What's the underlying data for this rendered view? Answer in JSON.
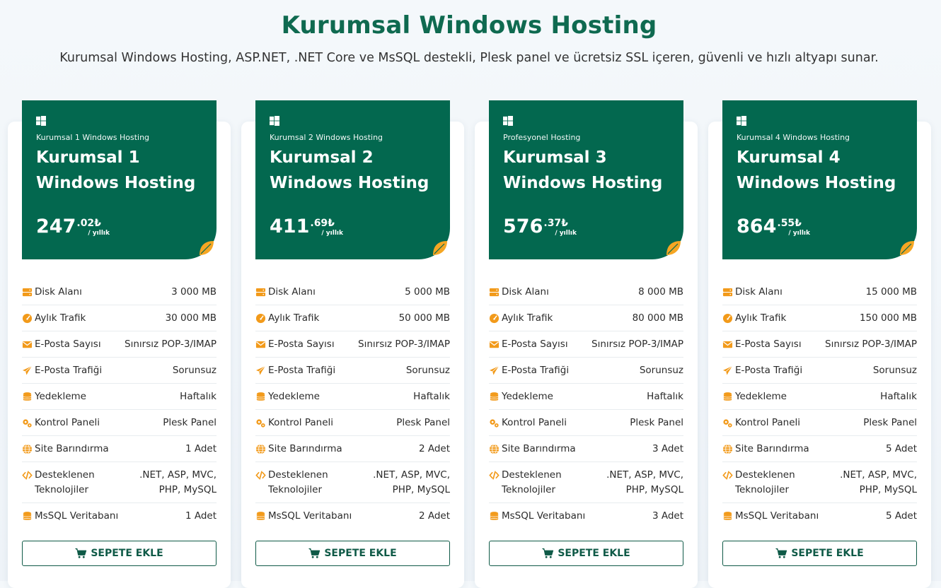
{
  "header": {
    "title": "Kurumsal Windows Hosting",
    "subtitle": "Kurumsal Windows Hosting, ASP.NET, .NET Core ve MsSQL destekli, Plesk panel ve ücretsiz SSL içeren, güvenli ve hızlı altyapı sunar."
  },
  "colors": {
    "brand": "#03684f",
    "accent": "#f5a623",
    "icon": "#f29a1a"
  },
  "labels": {
    "disk": "Disk Alanı",
    "traffic": "Aylık Trafik",
    "email_count": "E-Posta Sayısı",
    "email_traffic": "E-Posta Trafiği",
    "backup": "Yedekleme",
    "panel": "Kontrol Paneli",
    "sites": "Site Barındırma",
    "tech": "Desteklenen Teknolojiler",
    "mssql": "MsSQL Veritabanı"
  },
  "plans": [
    {
      "subtitle": "Kurumsal 1 Windows Hosting",
      "title": "Kurumsal 1 Windows Hosting",
      "price_int": "247",
      "price_dec": ".02₺",
      "price_per": "/ yıllık",
      "disk": "3 000 MB",
      "traffic": "30 000 MB",
      "email_count": "Sınırsız POP-3/IMAP",
      "email_traffic": "Sorunsuz",
      "backup": "Haftalık",
      "panel": "Plesk Panel",
      "sites": "1 Adet",
      "tech": ".NET, ASP, MVC, PHP, MySQL",
      "mssql": "1 Adet",
      "button": "SEPETE EKLE"
    },
    {
      "subtitle": "Kurumsal 2 Windows Hosting",
      "title": "Kurumsal 2 Windows Hosting",
      "price_int": "411",
      "price_dec": ".69₺",
      "price_per": "/ yıllık",
      "disk": "5 000 MB",
      "traffic": "50 000 MB",
      "email_count": "Sınırsız POP-3/IMAP",
      "email_traffic": "Sorunsuz",
      "backup": "Haftalık",
      "panel": "Plesk Panel",
      "sites": "2 Adet",
      "tech": ".NET, ASP, MVC, PHP, MySQL",
      "mssql": "2 Adet",
      "button": "SEPETE EKLE"
    },
    {
      "subtitle": "Profesyonel Hosting",
      "title": "Kurumsal 3 Windows Hosting",
      "price_int": "576",
      "price_dec": ".37₺",
      "price_per": "/ yıllık",
      "disk": "8 000 MB",
      "traffic": "80 000 MB",
      "email_count": "Sınırsız POP-3/IMAP",
      "email_traffic": "Sorunsuz",
      "backup": "Haftalık",
      "panel": "Plesk Panel",
      "sites": "3 Adet",
      "tech": ".NET, ASP, MVC, PHP, MySQL",
      "mssql": "3 Adet",
      "button": "SEPETE EKLE"
    },
    {
      "subtitle": "Kurumsal 4 Windows Hosting",
      "title": "Kurumsal 4 Windows Hosting",
      "price_int": "864",
      "price_dec": ".55₺",
      "price_per": "/ yıllık",
      "disk": "15 000 MB",
      "traffic": "150 000 MB",
      "email_count": "Sınırsız POP-3/IMAP",
      "email_traffic": "Sorunsuz",
      "backup": "Haftalık",
      "panel": "Plesk Panel",
      "sites": "5 Adet",
      "tech": ".NET, ASP, MVC, PHP, MySQL",
      "mssql": "5 Adet",
      "button": "SEPETE EKLE"
    }
  ]
}
